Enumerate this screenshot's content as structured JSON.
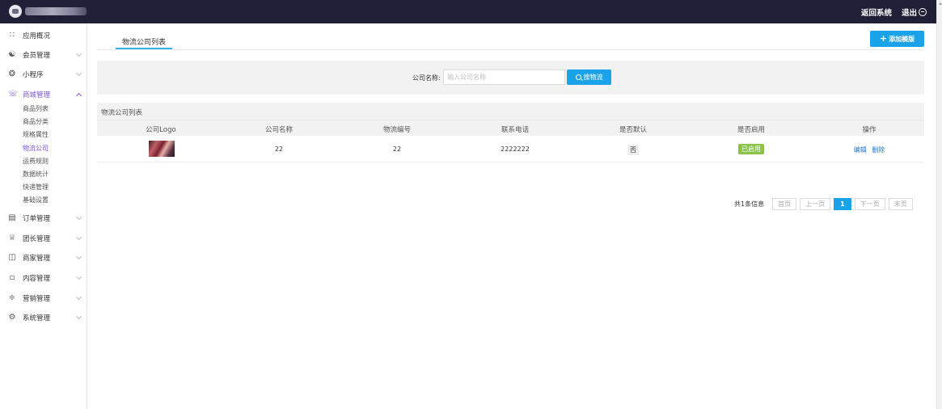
{
  "topbar": {
    "return_label": "返回系统",
    "logout_label": "退出"
  },
  "sidebar": {
    "items": [
      {
        "label": "应用概况",
        "icon": "grid-icon"
      },
      {
        "label": "会员管理",
        "icon": "users-icon"
      },
      {
        "label": "小程序",
        "icon": "miniprogram-icon"
      },
      {
        "label": "商城管理",
        "icon": "cart-icon"
      },
      {
        "label": "订单管理",
        "icon": "clipboard-icon"
      },
      {
        "label": "团长管理",
        "icon": "crown-icon"
      },
      {
        "label": "商家管理",
        "icon": "store-icon"
      },
      {
        "label": "内容管理",
        "icon": "document-icon"
      },
      {
        "label": "营销管理",
        "icon": "chart-icon"
      },
      {
        "label": "系统管理",
        "icon": "gear-icon"
      }
    ],
    "mall_sub": [
      "商品列表",
      "商品分类",
      "规格属性",
      "物流公司",
      "运费规则",
      "数据统计",
      "快递管理",
      "基础设置"
    ]
  },
  "main": {
    "tab_label": "物流公司列表",
    "add_button_label": "添加模版",
    "search": {
      "label": "公司名称:",
      "placeholder": "输入公司名称",
      "button_label": "搜物流"
    },
    "table": {
      "title": "物流公司列表",
      "headers": [
        "公司Logo",
        "公司名称",
        "物流编号",
        "联系电话",
        "是否默认",
        "是否启用",
        "操作"
      ],
      "rows": [
        {
          "name": "22",
          "code": "22",
          "phone": "2222222",
          "is_default": "否",
          "enabled": "已启用",
          "edit": "编辑",
          "delete": "删除"
        }
      ]
    },
    "pagination": {
      "info": "共1条信息",
      "first": "首页",
      "prev": "上一页",
      "current": "1",
      "next": "下一页",
      "last": "末页"
    }
  },
  "colors": {
    "topbar": "#1f1f38",
    "accent": "#1aa3e8",
    "active_nav": "#7a52e0",
    "enabled_badge": "#8bc34a"
  }
}
